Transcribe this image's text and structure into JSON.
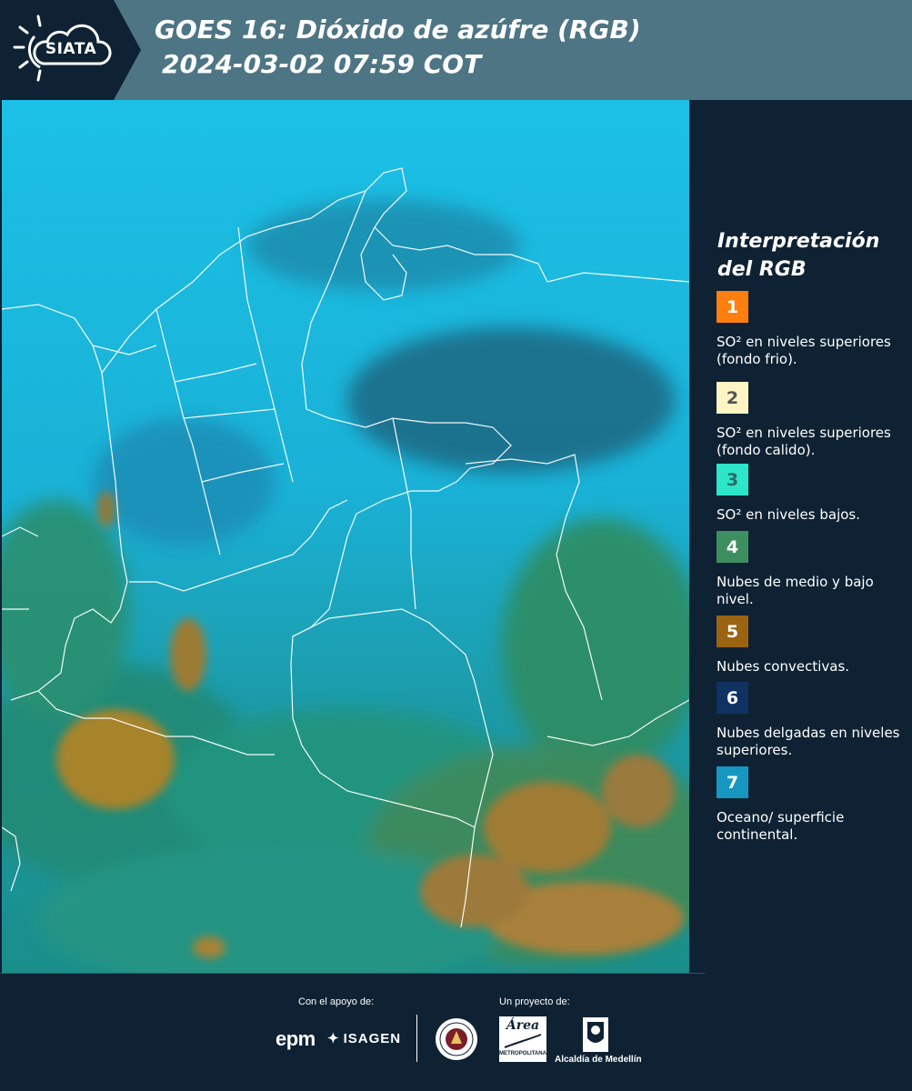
{
  "header": {
    "logo_text": "SIATA",
    "title_line1": "GOES 16: Dióxido de azúfre (RGB)",
    "title_line2": "2024-03-02 07:59 COT"
  },
  "legend": {
    "heading": "Interpretación del RGB",
    "items": [
      {
        "number": "1",
        "text": "SO² en niveles superiores (fondo frio).",
        "color": "#ff7f0e",
        "num_color": "#ffffff"
      },
      {
        "number": "2",
        "text": "SO² en niveles superiores (fondo calido).",
        "color": "#fdf5c4",
        "num_color": "#555555"
      },
      {
        "number": "3",
        "text": "SO² en niveles bajos.",
        "color": "#2de5c8",
        "num_color": "#2a6a66"
      },
      {
        "number": "4",
        "text": "Nubes de medio y bajo nivel.",
        "color": "#3e8f5f",
        "num_color": "#ffffff"
      },
      {
        "number": "5",
        "text": "Nubes convectivas.",
        "color": "#9a6413",
        "num_color": "#ffffff"
      },
      {
        "number": "6",
        "text": "Nubes delgadas en niveles superiores.",
        "color": "#0f3262",
        "num_color": "#ffffff"
      },
      {
        "number": "7",
        "text": "Oceano/ superficie continental.",
        "color": "#1597c2",
        "num_color": "#ffffff"
      }
    ]
  },
  "footer": {
    "support_label": "Con el apoyo de:",
    "project_label": "Un proyecto de:",
    "sponsor_epm": "epm",
    "sponsor_isagen": "ISAGEN",
    "area_name": "Área",
    "area_sub": "METROPOLITANA",
    "alcaldia": "Alcaldía de Medellín"
  }
}
